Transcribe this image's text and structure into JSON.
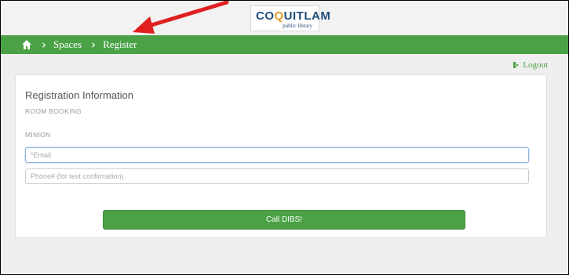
{
  "header": {
    "logo_name": "COQUITLAM",
    "logo_subtitle": "public library"
  },
  "breadcrumb": {
    "home_icon": "home-icon",
    "items": [
      "Spaces",
      "Register"
    ]
  },
  "logout_label": "Logout",
  "form": {
    "title": "Registration Information",
    "subtitle_1": "ROOM BOOKING",
    "subtitle_2": "MINION",
    "email_placeholder": "*Email",
    "phone_placeholder": "Phone# (for text confirmation)",
    "submit_label": "Call DIBS!"
  },
  "colors": {
    "nav_green": "#4aa146",
    "annotation_arrow": "#e02020"
  }
}
